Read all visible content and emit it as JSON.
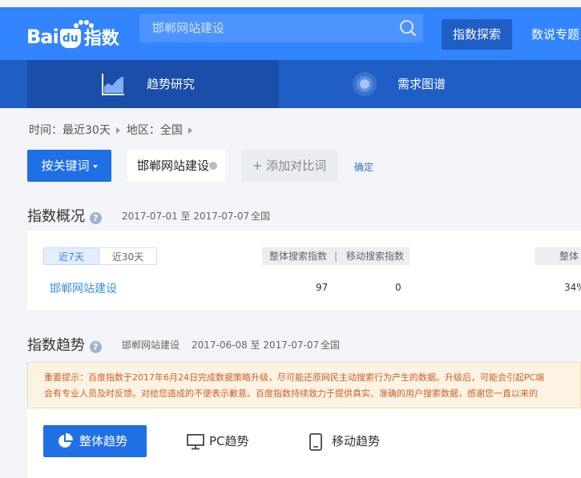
{
  "header": {
    "logo_text_bai": "Bai",
    "logo_text_du": "du",
    "logo_text_zhishu": "指数",
    "search_value": "邯郸网站建设",
    "explore_button": "指数探索",
    "nav_data_topics": "数说专题"
  },
  "subnav": {
    "trend": "趋势研究",
    "demand": "需求图谱"
  },
  "filters": {
    "time": "时间：最近30天",
    "region": "地区：全国",
    "keyword_button": "按关键词",
    "keyword_value": "邯郸网站建设",
    "add_compare": "+ 添加对比词",
    "confirm": "确定"
  },
  "overview": {
    "title": "指数概况",
    "date_range": "2017-07-01 至 2017-07-07",
    "region": "全国",
    "tabs": [
      "近7天",
      "近30天"
    ],
    "columns": [
      "整体搜索指数",
      "|",
      "移动搜索指数",
      "整体"
    ],
    "row": {
      "keyword": "邯郸网站建设",
      "overall": "97",
      "mobile": "0",
      "ratio": "34%"
    }
  },
  "trend": {
    "title": "指数趋势",
    "keyword": "邯郸网站建设",
    "date_range": "2017-06-08 至 2017-07-07",
    "region": "全国",
    "notice_line1": "重要提示：百度指数于2017年6月24日完成数据策略升级，尽可能还原网民主动搜索行为产生的数据。升级后，可能会引起PC端",
    "notice_line2": "会有专业人员及时反馈。对给您造成的不便表示歉意。百度指数持续致力于提供真实、准确的用户搜索数据，感谢您一直以来的",
    "tabs": [
      "整体趋势",
      "PC趋势",
      "移动趋势"
    ]
  },
  "colors": {
    "header_blue": "#3385ff",
    "subnav_blue": "#1f5fc5",
    "button_blue": "#1f6fe5",
    "notice_bg": "#fdf3e3",
    "notice_text": "#c9612c"
  }
}
